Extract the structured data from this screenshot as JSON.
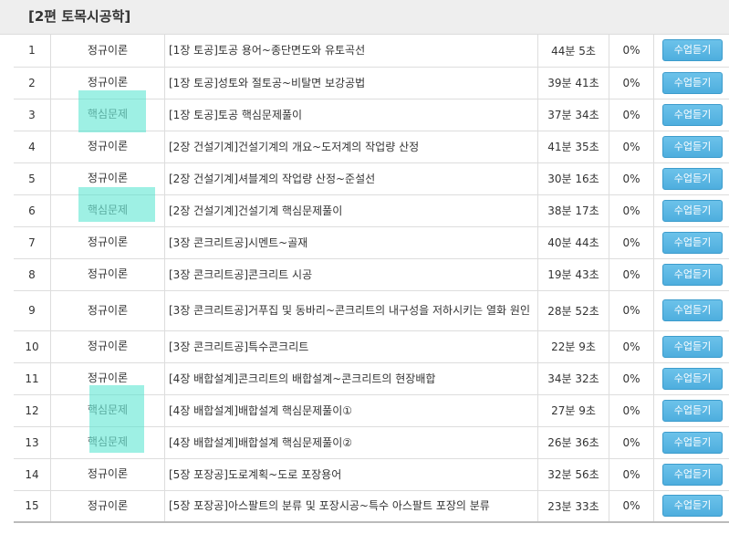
{
  "section": {
    "title": "[2편 토목시공학]"
  },
  "colors": {
    "button_bg": "#5bb6e2",
    "highlight": "#4fe3cd",
    "header_bg": "#eeeeee"
  },
  "lectures": [
    {
      "no": "1",
      "type": "정규이론",
      "title": "[1장 토공]토공 용어~종단면도와 유토곡선",
      "duration": "44분 5초",
      "progress": "0%",
      "button": "수업듣기",
      "highlighted": false
    },
    {
      "no": "2",
      "type": "정규이론",
      "title": "[1장 토공]성토와 절토공~비탈면 보강공법",
      "duration": "39분 41초",
      "progress": "0%",
      "button": "수업듣기",
      "highlighted": false
    },
    {
      "no": "3",
      "type": "핵심문제",
      "title": "[1장 토공]토공 핵심문제풀이",
      "duration": "37분 34초",
      "progress": "0%",
      "button": "수업듣기",
      "highlighted": true
    },
    {
      "no": "4",
      "type": "정규이론",
      "title": "[2장 건설기계]건설기계의 개요~도저계의 작업량 산정",
      "duration": "41분 35초",
      "progress": "0%",
      "button": "수업듣기",
      "highlighted": false
    },
    {
      "no": "5",
      "type": "정규이론",
      "title": "[2장 건설기계]셔블계의 작업량 산정~준설선",
      "duration": "30분 16초",
      "progress": "0%",
      "button": "수업듣기",
      "highlighted": false
    },
    {
      "no": "6",
      "type": "핵심문제",
      "title": "[2장 건설기계]건설기계 핵심문제풀이",
      "duration": "38분 17초",
      "progress": "0%",
      "button": "수업듣기",
      "highlighted": true
    },
    {
      "no": "7",
      "type": "정규이론",
      "title": "[3장 콘크리트공]시멘트~골재",
      "duration": "40분 44초",
      "progress": "0%",
      "button": "수업듣기",
      "highlighted": false
    },
    {
      "no": "8",
      "type": "정규이론",
      "title": "[3장 콘크리트공]콘크리트 시공",
      "duration": "19분 43초",
      "progress": "0%",
      "button": "수업듣기",
      "highlighted": false
    },
    {
      "no": "9",
      "type": "정규이론",
      "title": "[3장 콘크리트공]거푸집 및 동바리~콘크리트의 내구성을 저하시키는 열화 원인",
      "duration": "28분 52초",
      "progress": "0%",
      "button": "수업듣기",
      "highlighted": false
    },
    {
      "no": "10",
      "type": "정규이론",
      "title": "[3장 콘크리트공]특수콘크리트",
      "duration": "22분 9초",
      "progress": "0%",
      "button": "수업듣기",
      "highlighted": false
    },
    {
      "no": "11",
      "type": "정규이론",
      "title": "[4장 배합설계]콘크리트의 배합설계~콘크리트의 현장배합",
      "duration": "34분 32초",
      "progress": "0%",
      "button": "수업듣기",
      "highlighted": false
    },
    {
      "no": "12",
      "type": "핵심문제",
      "title": "[4장 배합설계]배합설계 핵심문제풀이①",
      "duration": "27분 9초",
      "progress": "0%",
      "button": "수업듣기",
      "highlighted": true
    },
    {
      "no": "13",
      "type": "핵심문제",
      "title": "[4장 배합설계]배합설계 핵심문제풀이②",
      "duration": "26분 36초",
      "progress": "0%",
      "button": "수업듣기",
      "highlighted": true
    },
    {
      "no": "14",
      "type": "정규이론",
      "title": "[5장 포장공]도로계획~도로 포장용어",
      "duration": "32분 56초",
      "progress": "0%",
      "button": "수업듣기",
      "highlighted": false
    },
    {
      "no": "15",
      "type": "정규이론",
      "title": "[5장 포장공]아스팔트의 분류 및 포장시공~특수 아스팔트 포장의 분류",
      "duration": "23분 33초",
      "progress": "0%",
      "button": "수업듣기",
      "highlighted": false
    }
  ]
}
